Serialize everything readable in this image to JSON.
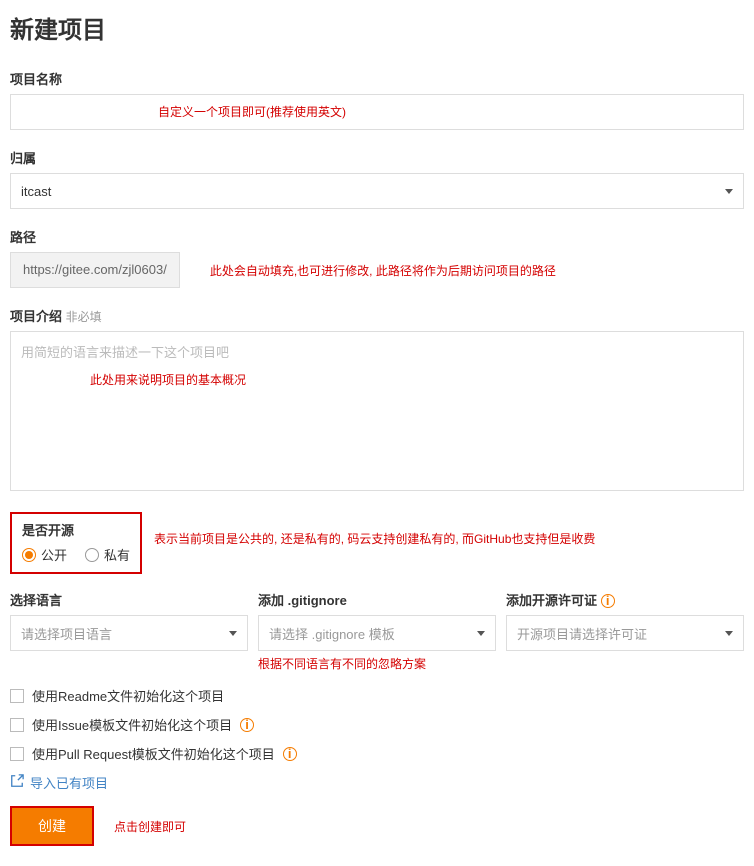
{
  "page_title": "新建项目",
  "labels": {
    "name": "项目名称",
    "owner": "归属",
    "path": "路径",
    "desc": "项目介绍",
    "desc_optional": "非必填",
    "visibility": "是否开源",
    "lang": "选择语言",
    "gitignore": "添加 .gitignore",
    "license": "添加开源许可证"
  },
  "values": {
    "owner": "itcast",
    "path_prefix": "https://gitee.com/zjl0603/"
  },
  "placeholders": {
    "desc": "用简短的语言来描述一下这个项目吧",
    "lang": "请选择项目语言",
    "gitignore": "请选择 .gitignore 模板",
    "license": "开源项目请选择许可证"
  },
  "visibility": {
    "public": "公开",
    "private": "私有"
  },
  "checkboxes": {
    "readme": "使用Readme文件初始化这个项目",
    "issue": "使用Issue模板文件初始化这个项目",
    "pr": "使用Pull Request模板文件初始化这个项目"
  },
  "import_text": "导入已有项目",
  "create_label": "创建",
  "annotations": {
    "name": "自定义一个项目即可(推荐使用英文)",
    "path": "此处会自动填充,也可进行修改, 此路径将作为后期访问项目的路径",
    "desc": "此处用来说明项目的基本概况",
    "visibility": "表示当前项目是公共的, 还是私有的, 码云支持创建私有的, 而GitHub也支持但是收费",
    "gitignore": "根据不同语言有不同的忽略方案",
    "create": "点击创建即可"
  }
}
